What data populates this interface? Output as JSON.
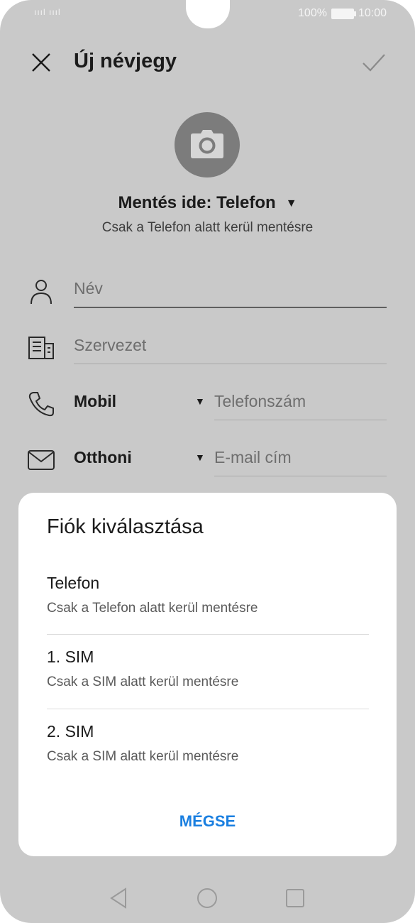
{
  "status_bar": {
    "signal": "ıııl ıııl",
    "battery_percent": "100%",
    "time": "10:00"
  },
  "header": {
    "title": "Új névjegy"
  },
  "save_location": {
    "label": "Mentés ide: Telefon",
    "subtitle": "Csak a Telefon alatt kerül mentésre"
  },
  "fields": {
    "name_placeholder": "Név",
    "org_placeholder": "Szervezet",
    "phone_type": "Mobil",
    "phone_placeholder": "Telefonszám",
    "email_type": "Otthoni",
    "email_placeholder": "E-mail cím"
  },
  "dialog": {
    "title": "Fiók kiválasztása",
    "options": [
      {
        "name": "Telefon",
        "description": "Csak a Telefon alatt kerül mentésre"
      },
      {
        "name": "1. SIM",
        "description": "Csak a SIM alatt kerül mentésre"
      },
      {
        "name": "2. SIM",
        "description": "Csak a SIM alatt kerül mentésre"
      }
    ],
    "cancel_label": "MÉGSE"
  },
  "colors": {
    "accent": "#1a7fe0",
    "scrim": "#c9c9c9",
    "sheet": "#ffffff"
  }
}
